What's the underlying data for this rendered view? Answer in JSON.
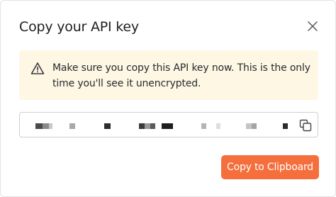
{
  "dialog": {
    "title": "Copy your API key",
    "close_icon": "close-icon"
  },
  "warning": {
    "icon": "warning-triangle-icon",
    "message": "Make sure you copy this API key now. This is the only time you'll see it unencrypted."
  },
  "api_key_field": {
    "value_state": "redacted",
    "copy_icon": "copy-icon"
  },
  "actions": {
    "copy_label": "Copy to Clipboard"
  },
  "colors": {
    "accent": "#f56f3d",
    "warning_bg": "#fdf7e4",
    "text": "#1f1f24"
  }
}
